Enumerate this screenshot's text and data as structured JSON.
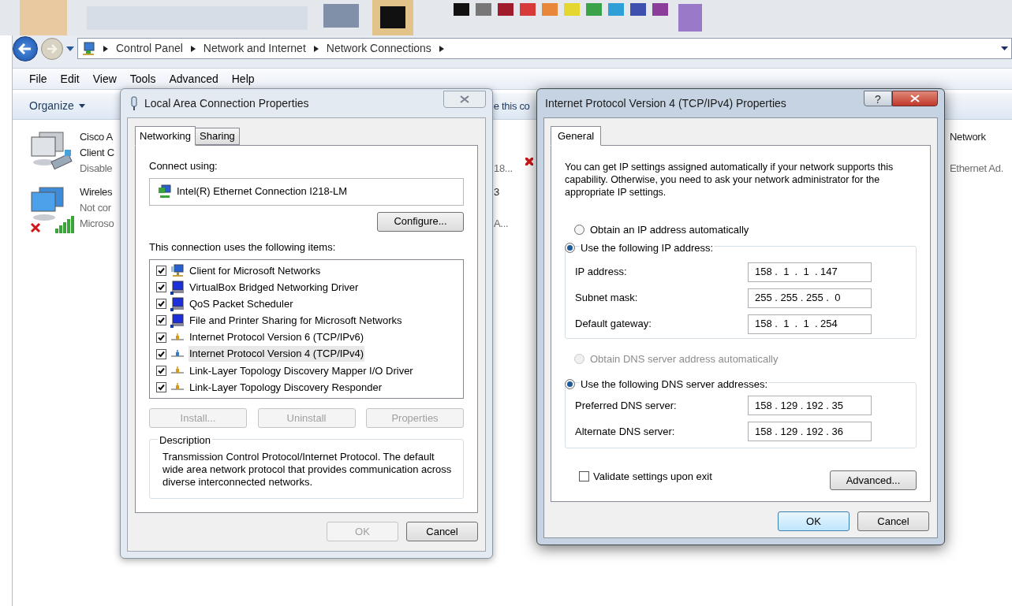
{
  "address_bar": {
    "breadcrumbs": [
      "Control Panel",
      "Network and Internet",
      "Network Connections"
    ]
  },
  "menu_bar": [
    "File",
    "Edit",
    "View",
    "Tools",
    "Advanced",
    "Help"
  ],
  "toolbar": {
    "organize": "Organize",
    "fragment": "e this co"
  },
  "connections": [
    {
      "kind": "cisco",
      "name_lines": [
        "Cisco A",
        "Client C"
      ],
      "status": "Disable"
    },
    {
      "kind": "wireless",
      "name_lines": [
        "Wireles"
      ],
      "status": "Not cor",
      "device": "Microso"
    }
  ],
  "column_2": [
    {
      "device": "18..."
    },
    {
      "name_lines": [
        "3"
      ],
      "device": "A..."
    }
  ],
  "column_3": [
    {
      "name_lines": [
        "Network"
      ],
      "device": "Ethernet Ad."
    }
  ],
  "lan_dialog": {
    "title": "Local Area Connection Properties",
    "tabs": [
      {
        "label": "Networking",
        "selected": true
      },
      {
        "label": "Sharing",
        "selected": false
      }
    ],
    "connect_using_label": "Connect using:",
    "adapter": "Intel(R) Ethernet Connection I218-LM",
    "configure": "Configure...",
    "items_label": "This connection uses the following items:",
    "items": [
      {
        "label": "Client for Microsoft Networks",
        "checked": true,
        "selected": false,
        "kind": "client"
      },
      {
        "label": "VirtualBox Bridged Networking Driver",
        "checked": true,
        "selected": false,
        "kind": "service"
      },
      {
        "label": "QoS Packet Scheduler",
        "checked": true,
        "selected": false,
        "kind": "service"
      },
      {
        "label": "File and Printer Sharing for Microsoft Networks",
        "checked": true,
        "selected": false,
        "kind": "service"
      },
      {
        "label": "Internet Protocol Version 6 (TCP/IPv6)",
        "checked": true,
        "selected": false,
        "kind": "protocol",
        "color": "#d59a1c"
      },
      {
        "label": "Internet Protocol Version 4 (TCP/IPv4)",
        "checked": true,
        "selected": true,
        "kind": "protocol",
        "color": "#3a7cc0"
      },
      {
        "label": "Link-Layer Topology Discovery Mapper I/O Driver",
        "checked": true,
        "selected": false,
        "kind": "protocol",
        "color": "#d59a1c"
      },
      {
        "label": "Link-Layer Topology Discovery Responder",
        "checked": true,
        "selected": false,
        "kind": "protocol",
        "color": "#d59a1c"
      }
    ],
    "item_buttons": [
      {
        "label": "Install...",
        "disabled": true
      },
      {
        "label": "Uninstall",
        "disabled": true
      },
      {
        "label": "Properties",
        "disabled": true
      }
    ],
    "description": {
      "title": "Description",
      "text": "Transmission Control Protocol/Internet Protocol. The default wide area network protocol that provides communication across diverse interconnected networks."
    },
    "buttons": [
      {
        "label": "OK",
        "disabled": true
      },
      {
        "label": "Cancel",
        "disabled": false
      }
    ]
  },
  "ipv4_dialog": {
    "title": "Internet Protocol Version 4 (TCP/IPv4) Properties",
    "help": "?",
    "tabs": [
      {
        "label": "General",
        "selected": true
      }
    ],
    "intro": "You can get IP settings assigned automatically if your network supports this capability. Otherwise, you need to ask your network administrator for the appropriate IP settings.",
    "ip_mode": [
      {
        "label": "Obtain an IP address automatically",
        "selected": false,
        "disabled": false
      },
      {
        "label": "Use the following IP address:",
        "selected": true,
        "disabled": false
      }
    ],
    "ip_fields": [
      {
        "label": "IP address:",
        "value": "158 .  1  .  1  . 147"
      },
      {
        "label": "Subnet mask:",
        "value": "255 . 255 . 255 .  0"
      },
      {
        "label": "Default gateway:",
        "value": "158 .  1  .  1  . 254"
      }
    ],
    "dns_mode": [
      {
        "label": "Obtain DNS server address automatically",
        "selected": false,
        "disabled": true
      },
      {
        "label": "Use the following DNS server addresses:",
        "selected": true,
        "disabled": false
      }
    ],
    "dns_fields": [
      {
        "label": "Preferred DNS server:",
        "value": "158 . 129 . 192 . 35"
      },
      {
        "label": "Alternate DNS server:",
        "value": "158 . 129 . 192 . 36"
      }
    ],
    "validate": {
      "label": "Validate settings upon exit",
      "checked": false
    },
    "advanced": "Advanced...",
    "buttons": [
      {
        "label": "OK",
        "kind": "default"
      },
      {
        "label": "Cancel",
        "kind": "normal"
      }
    ]
  }
}
